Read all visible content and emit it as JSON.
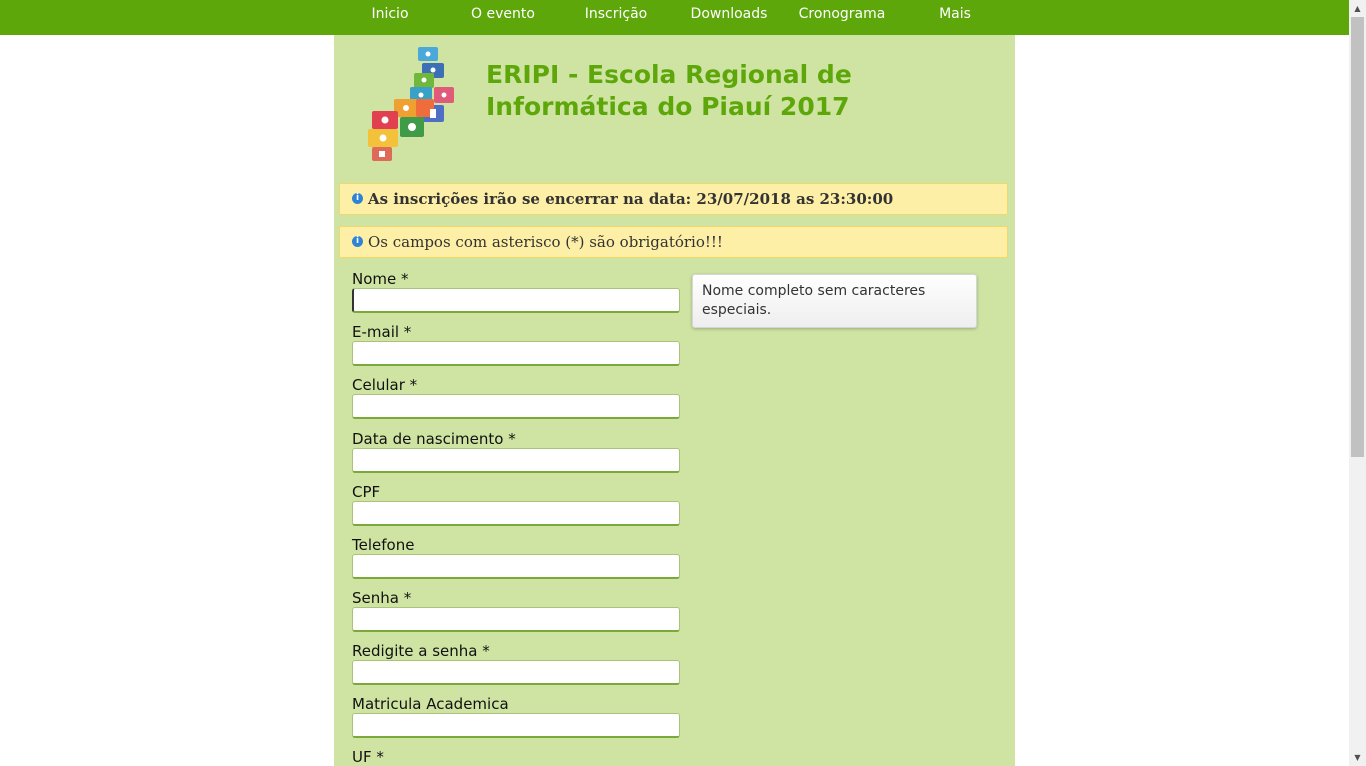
{
  "nav": {
    "items": [
      {
        "label": "Inicio"
      },
      {
        "label": "O evento"
      },
      {
        "label": "Inscrição"
      },
      {
        "label": "Downloads"
      },
      {
        "label": "Cronograma"
      },
      {
        "label": "Mais"
      }
    ]
  },
  "header": {
    "title": "ERIPI - Escola Regional de Informática do Piauí 2017"
  },
  "notices": [
    {
      "text": "As inscrições irão se encerrar na data: 23/07/2018 as 23:30:00",
      "icon": "info-icon"
    },
    {
      "text": "Os campos com asterisco (*) são obrigatório!!!",
      "icon": "info-icon"
    }
  ],
  "form": {
    "fields": [
      {
        "label": "Nome *",
        "value": ""
      },
      {
        "label": "E-mail *",
        "value": ""
      },
      {
        "label": "Celular *",
        "value": ""
      },
      {
        "label": "Data de nascimento *",
        "value": ""
      },
      {
        "label": "CPF",
        "value": ""
      },
      {
        "label": "Telefone",
        "value": ""
      },
      {
        "label": "Senha *",
        "value": ""
      },
      {
        "label": "Redigite a senha *",
        "value": ""
      },
      {
        "label": "Matricula Academica",
        "value": ""
      },
      {
        "label": "UF *"
      }
    ]
  },
  "tooltip": {
    "text": "Nome completo sem caracteres especiais."
  },
  "colors": {
    "nav_bg": "#5ea70a",
    "content_bg": "#cfe4a3",
    "title": "#5ea70a",
    "notice_bg": "#fdefa6"
  }
}
